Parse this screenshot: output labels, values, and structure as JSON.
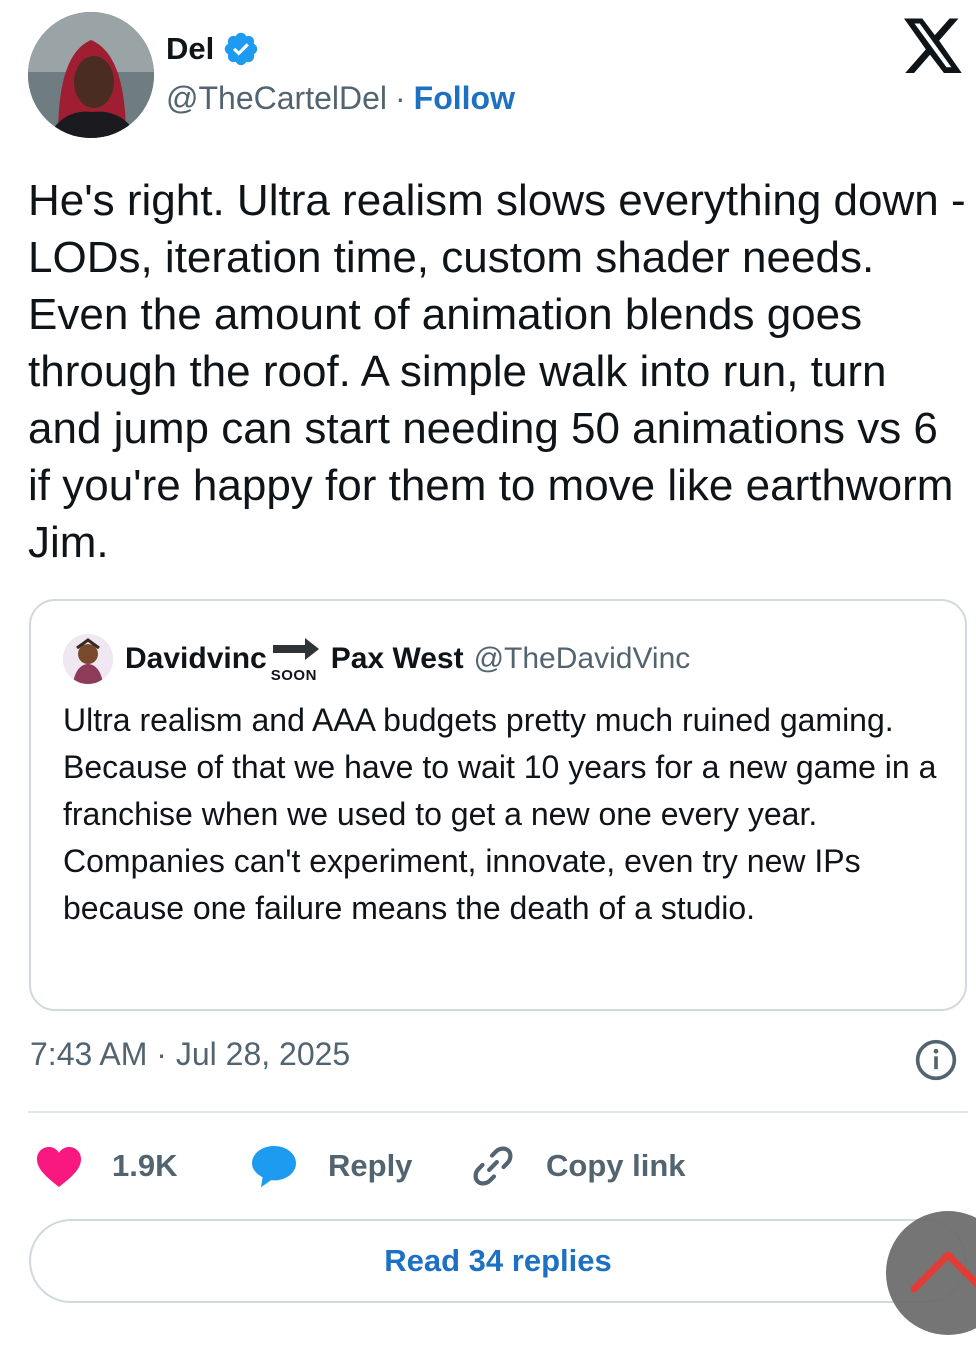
{
  "author": {
    "name": "Del",
    "handle": "@TheCartelDel",
    "separator": "·",
    "follow_label": "Follow",
    "verified": true
  },
  "platform_logo": "x-logo-icon",
  "tweet": {
    "text": "He's right. Ultra realism slows everything down - LODs, iteration time, custom shader needs. Even the amount of animation blends goes through the roof. A simple walk into run, turn and jump can start needing 50 animations vs 6 if you're happy for them to move like earthworm Jim.",
    "timestamp": "7:43 AM · Jul 28, 2025"
  },
  "quoted_tweet": {
    "author_name": "Davidvinc",
    "badge_text": "SOON",
    "author_name_suffix": "Pax West",
    "handle": "@TheDavidVinc",
    "text": "Ultra realism and AAA budgets pretty much ruined gaming. Because of that we have to wait 10 years for a new game in a franchise when we used to get a new one every year. Companies can't experiment, innovate, even try new IPs because one failure means the death of a studio."
  },
  "actions": {
    "likes_count": "1.9K",
    "reply_label": "Reply",
    "copy_link_label": "Copy link"
  },
  "read_replies_label": "Read 34 replies",
  "colors": {
    "accent": "#1d70c2",
    "verified": "#1d9bf0",
    "like": "#f91880",
    "reply": "#1d9bf0",
    "muted_text": "#536471",
    "border": "#cfd9de"
  },
  "icons": {
    "verified": "verified-badge-icon",
    "info": "info-icon",
    "like": "heart-icon",
    "reply": "speech-bubble-icon",
    "copy": "link-icon",
    "scroll_top": "chevron-up-icon"
  }
}
